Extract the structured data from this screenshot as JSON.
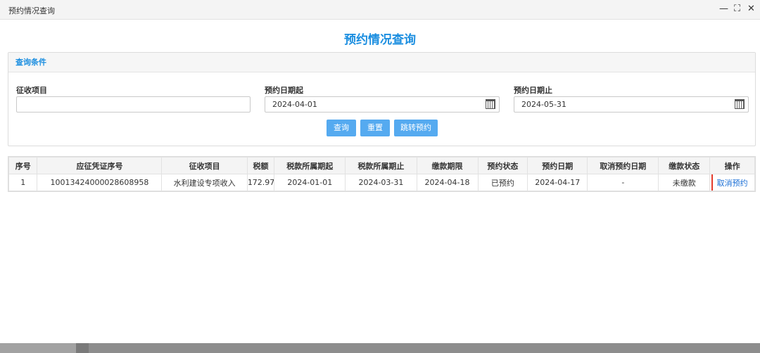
{
  "window": {
    "title": "预约情况查询",
    "controls": {
      "minimize": "—",
      "maximize": "⛶",
      "close": "✕"
    }
  },
  "page": {
    "title": "预约情况查询"
  },
  "query": {
    "section_title": "查询条件",
    "fields": {
      "project_label": "征收项目",
      "project_value": "",
      "date_from_label": "预约日期起",
      "date_from_value": "2024-04-01",
      "date_to_label": "预约日期止",
      "date_to_value": "2024-05-31"
    },
    "buttons": {
      "search": "查询",
      "reset": "重置",
      "jump": "跳转预约"
    }
  },
  "table": {
    "headers": [
      "序号",
      "应征凭证序号",
      "征收项目",
      "税额",
      "税款所属期起",
      "税款所属期止",
      "缴款期限",
      "预约状态",
      "预约日期",
      "取消预约日期",
      "缴款状态",
      "操作"
    ],
    "rows": [
      {
        "index": "1",
        "voucher_no": "10013424000028608958",
        "project": "水利建设专项收入",
        "tax_amount": "172.97",
        "period_start": "2024-01-01",
        "period_end": "2024-03-31",
        "deadline": "2024-04-18",
        "reservation_status": "已预约",
        "reservation_date": "2024-04-17",
        "cancel_date": "-",
        "payment_status": "未缴款",
        "action": "取消预约"
      }
    ]
  },
  "colors": {
    "accent": "#1b8ee0",
    "button": "#55aaf0",
    "highlight": "#e53b2c",
    "link": "#1b6fd6"
  }
}
